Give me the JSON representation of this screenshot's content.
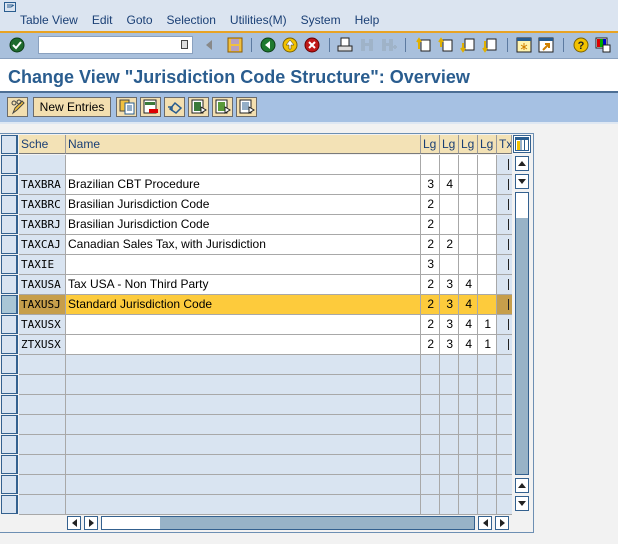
{
  "menubar": {
    "items": [
      {
        "label": "Table View",
        "mnemonic": "T"
      },
      {
        "label": "Edit",
        "mnemonic": "E"
      },
      {
        "label": "Goto",
        "mnemonic": "G"
      },
      {
        "label": "Selection",
        "mnemonic": "S"
      },
      {
        "label": "Utilities(M)",
        "mnemonic": "M"
      },
      {
        "label": "System",
        "mnemonic": "y"
      },
      {
        "label": "Help",
        "mnemonic": "H"
      }
    ]
  },
  "toolbar": {
    "command_field": {
      "value": "",
      "placeholder": ""
    },
    "icons": [
      "enter-icon",
      "save-icon",
      "back-icon",
      "exit-icon",
      "cancel-icon",
      "print-icon",
      "find-icon",
      "find-next-icon",
      "first-page-icon",
      "previous-page-icon",
      "next-page-icon",
      "last-page-icon",
      "create-session-icon",
      "shortcut-icon",
      "help-icon",
      "customize-layout-icon"
    ]
  },
  "page": {
    "title": "Change View \"Jurisdiction Code Structure\": Overview"
  },
  "app_toolbar": {
    "new_entries_label": "New Entries"
  },
  "table": {
    "columns": [
      "Sche",
      "Name",
      "Lg",
      "Lg",
      "Lg",
      "Lg",
      "Tx"
    ],
    "rows": [
      {
        "key": "",
        "name": "",
        "lg1": "",
        "lg2": "",
        "lg3": "",
        "lg4": "",
        "selected": false
      },
      {
        "key": "TAXBRA",
        "name": "Brazilian CBT Procedure",
        "lg1": "3",
        "lg2": "4",
        "lg3": "",
        "lg4": "",
        "selected": false
      },
      {
        "key": "TAXBRC",
        "name": "Brasilian Jurisdiction Code",
        "lg1": "2",
        "lg2": "",
        "lg3": "",
        "lg4": "",
        "selected": false
      },
      {
        "key": "TAXBRJ",
        "name": "Brasilian Jurisdiction Code",
        "lg1": "2",
        "lg2": "",
        "lg3": "",
        "lg4": "",
        "selected": false
      },
      {
        "key": "TAXCAJ",
        "name": "Canadian Sales Tax, with Jurisdiction",
        "lg1": "2",
        "lg2": "2",
        "lg3": "",
        "lg4": "",
        "selected": false
      },
      {
        "key": "TAXIE",
        "name": "",
        "lg1": "3",
        "lg2": "",
        "lg3": "",
        "lg4": "",
        "selected": false
      },
      {
        "key": "TAXUSA",
        "name": "Tax USA - Non Third Party",
        "lg1": "2",
        "lg2": "3",
        "lg3": "4",
        "lg4": "",
        "selected": false
      },
      {
        "key": "TAXUSJ",
        "name": "Standard Jurisdiction Code",
        "lg1": "2",
        "lg2": "3",
        "lg3": "4",
        "lg4": "",
        "selected": true
      },
      {
        "key": "TAXUSX",
        "name": "",
        "lg1": "2",
        "lg2": "3",
        "lg3": "4",
        "lg4": "1",
        "selected": false
      },
      {
        "key": "ZTXUSX",
        "name": "",
        "lg1": "2",
        "lg2": "3",
        "lg3": "4",
        "lg4": "1",
        "selected": false
      }
    ],
    "empty_rows": 8
  },
  "colors": {
    "title": "#2a5d8f",
    "selected_row": "#fdcb3c",
    "selected_key": "#c69e4b",
    "header_bg": "#f3e2b6"
  }
}
